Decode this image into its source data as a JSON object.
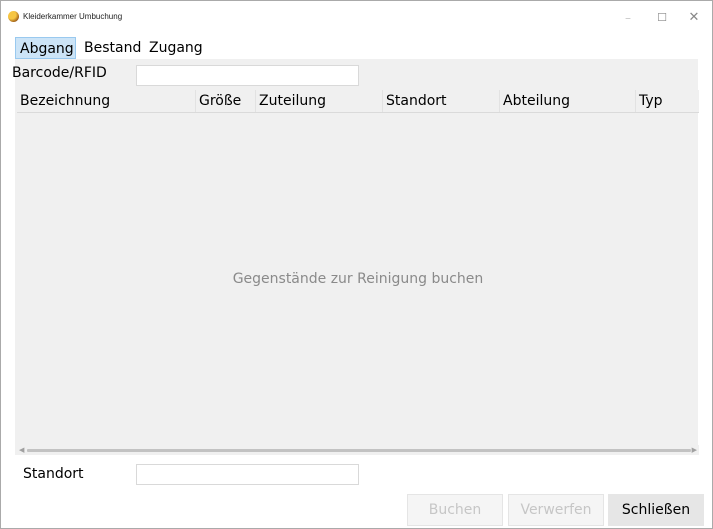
{
  "window": {
    "title": "Kleiderkammer Umbuchung",
    "controls": {
      "minimize": "–",
      "maximize": "☐",
      "close": "✕"
    }
  },
  "tabs": [
    {
      "label": "Abgang",
      "selected": true
    },
    {
      "label": "Bestand",
      "selected": false
    },
    {
      "label": "Zugang",
      "selected": false
    }
  ],
  "barcode": {
    "label": "Barcode/RFID",
    "value": ""
  },
  "table": {
    "columns": [
      "Bezeichnung",
      "Größe",
      "Zuteilung",
      "Standort",
      "Abteilung",
      "Typ"
    ],
    "rows": [],
    "empty_message": "Gegenstände zur Reinigung buchen"
  },
  "standort": {
    "label": "Standort",
    "value": ""
  },
  "buttons": {
    "book": {
      "label": "Buchen",
      "enabled": false
    },
    "discard": {
      "label": "Verwerfen",
      "enabled": false
    },
    "close": {
      "label": "Schließen",
      "enabled": true
    }
  },
  "colors": {
    "selected_tab_bg": "#cce4f7",
    "panel_bg": "#f0f0f0",
    "disabled_text": "#c6c6c6",
    "placeholder_text": "#8a8a8a"
  }
}
